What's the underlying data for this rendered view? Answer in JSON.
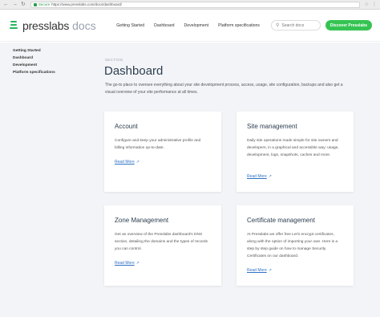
{
  "browser": {
    "secure_label": "Secure",
    "url": "https://www.presslabs.com/docs/dashboard/"
  },
  "header": {
    "logo_text": "presslabs",
    "logo_docs": "docs",
    "nav": [
      "Getting Started",
      "Dashboard",
      "Development",
      "Platform specifications"
    ],
    "search_placeholder": "Search docs",
    "cta_label": "Discover Presslabs",
    "accent_color": "#35c452"
  },
  "sidebar": {
    "items": [
      {
        "label": "Getting Started"
      },
      {
        "label": "Dashboard"
      },
      {
        "label": "Development"
      },
      {
        "label": "Platform specifications"
      }
    ]
  },
  "main": {
    "section_label": "SECTION",
    "title": "Dashboard",
    "intro": "The go-to place to oversee everything about your site development process, access, usage, site configuration, backups and also get a visual overview of your site performance at all times.",
    "cards": [
      {
        "title": "Account",
        "body": "Configure and keep your administrative profile and billing information up-to-date.",
        "link": "Read More",
        "link_icon": "arrow-up-right-icon"
      },
      {
        "title": "Site management",
        "body": "Daily site operations made simple for site owners and developers, in a graphical and accessible way: usage, development, logs, snapshots, caches and more.",
        "link": "Read More",
        "link_icon": "arrow-up-right-icon"
      },
      {
        "title": "Zone Management",
        "body": "Get an overview of the Presslabs dashboard's DNS section, detailing the domains and the types of records you can control.",
        "link": "Read More",
        "link_icon": "arrow-up-right-icon"
      },
      {
        "title": "Certificate management",
        "body": "At Presslabs we offer free Let's encrypt certificates, along with the option of importing your own. Here is a step by step guide on how to manage Security Certificates on our dashboard.",
        "link": "Read More",
        "link_icon": "arrow-up-right-icon"
      }
    ]
  }
}
